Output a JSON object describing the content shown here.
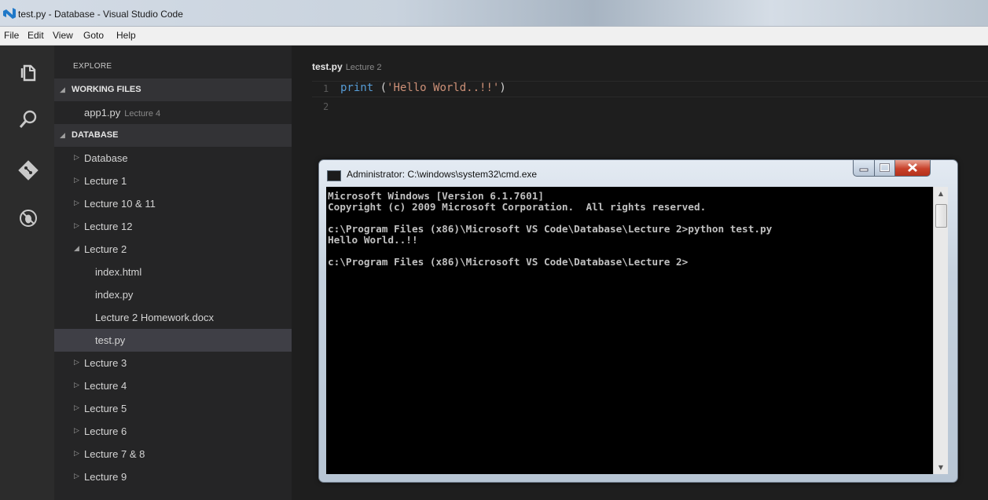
{
  "window": {
    "title": "test.py - Database - Visual Studio Code"
  },
  "menu": [
    "File",
    "Edit",
    "View",
    "Goto",
    "Help"
  ],
  "activity_icons": [
    "files-icon",
    "search-icon",
    "git-icon",
    "debug-icon"
  ],
  "sidebar": {
    "explore_label": "EXPLORE",
    "working_files_header": "WORKING FILES",
    "working_files": [
      {
        "name": "app1.py",
        "folder": "Lecture 4"
      }
    ],
    "database_header": "DATABASE",
    "tree": [
      {
        "label": "Database",
        "caret": "▷"
      },
      {
        "label": "Lecture 1",
        "caret": "▷"
      },
      {
        "label": "Lecture 10 & 11",
        "caret": "▷"
      },
      {
        "label": "Lecture 12",
        "caret": "▷"
      },
      {
        "label": "Lecture 2",
        "caret": "◢"
      },
      {
        "label": "index.html"
      },
      {
        "label": "index.py"
      },
      {
        "label": "Lecture 2 Homework.docx"
      },
      {
        "label": "test.py"
      },
      {
        "label": "Lecture 3",
        "caret": "▷"
      },
      {
        "label": "Lecture 4",
        "caret": "▷"
      },
      {
        "label": "Lecture 5",
        "caret": "▷"
      },
      {
        "label": "Lecture 6",
        "caret": "▷"
      },
      {
        "label": "Lecture 7 & 8",
        "caret": "▷"
      },
      {
        "label": "Lecture 9",
        "caret": "▷"
      }
    ]
  },
  "editor": {
    "file_title": "test.py",
    "file_folder": "Lecture 2",
    "line_numbers": [
      "1",
      "2"
    ],
    "code": {
      "keyword": "print",
      "open": " (",
      "string": "'Hello World..!!'",
      "close": ")"
    }
  },
  "cmd": {
    "title": "Administrator: C:\\windows\\system32\\cmd.exe",
    "lines": [
      "Microsoft Windows [Version 6.1.7601]",
      "Copyright (c) 2009 Microsoft Corporation.  All rights reserved.",
      "",
      "c:\\Program Files (x86)\\Microsoft VS Code\\Database\\Lecture 2>python test.py",
      "Hello World..!!",
      "",
      "c:\\Program Files (x86)\\Microsoft VS Code\\Database\\Lecture 2>"
    ]
  },
  "colors": {
    "keyword": "#569cd6",
    "string": "#ce9178",
    "sidebar_bg": "#252526",
    "editor_bg": "#1e1e1e",
    "selected_row": "#3f3f46",
    "close_button": "#c8412a"
  }
}
